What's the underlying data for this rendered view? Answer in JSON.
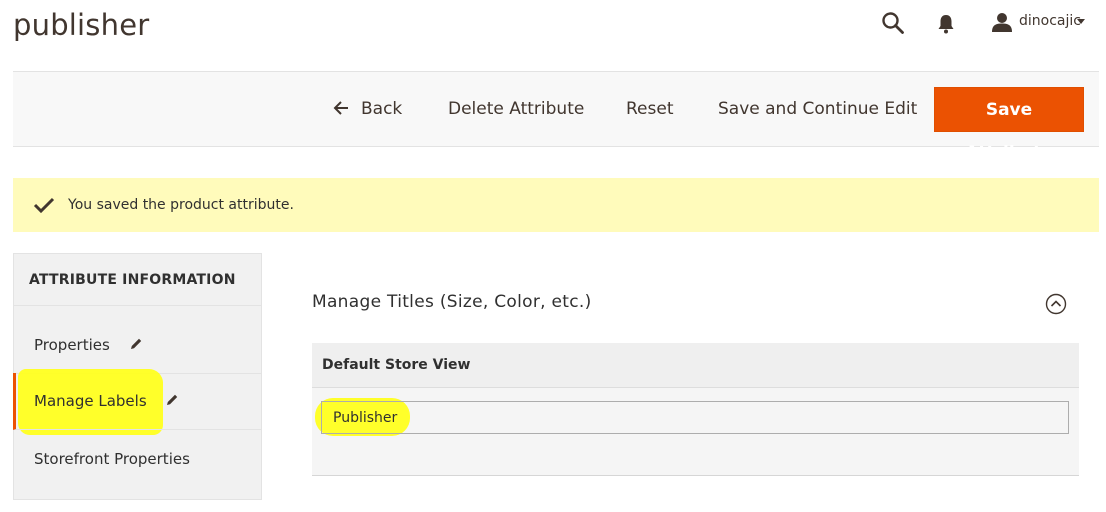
{
  "page": {
    "title": "publisher"
  },
  "header": {
    "user_name": "dinocajic",
    "icons": [
      "search-icon",
      "bell-icon",
      "user-icon",
      "caret-down-icon"
    ]
  },
  "toolbar": {
    "back_label": "Back",
    "delete_label": "Delete Attribute",
    "reset_label": "Reset",
    "save_continue_label": "Save and Continue Edit",
    "save_label": "Save Attribute"
  },
  "message": {
    "text": "You saved the product attribute."
  },
  "sidebar": {
    "title": "ATTRIBUTE INFORMATION",
    "items": [
      {
        "label": "Properties",
        "edited": true
      },
      {
        "label": "Manage Labels",
        "edited": true,
        "active": true
      },
      {
        "label": "Storefront Properties",
        "edited": false
      }
    ]
  },
  "section": {
    "title": "Manage Titles (Size, Color, etc.)",
    "store_header": "Default Store View",
    "label_value": "Publisher"
  },
  "colors": {
    "accent": "#eb5202",
    "message_bg": "#fffbbb",
    "highlight": "#ffff1f"
  }
}
